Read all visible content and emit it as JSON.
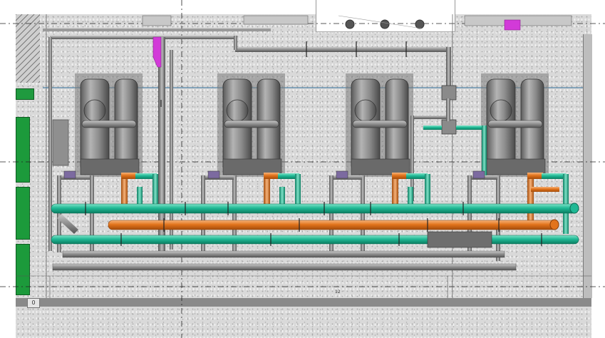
{
  "drawing": {
    "type": "mechanical room 3D plan view",
    "chiller_count": 4,
    "fan_count": 3,
    "pipe_colors": {
      "chilled_water": "#1fb894",
      "condenser_water": "#e2741c",
      "grey_piping": "#8d8d8d",
      "accent_magenta": "#d23ad8",
      "guide_line_blue": "#2f6f9a"
    },
    "annotation_marks": [
      "0",
      "12"
    ]
  }
}
